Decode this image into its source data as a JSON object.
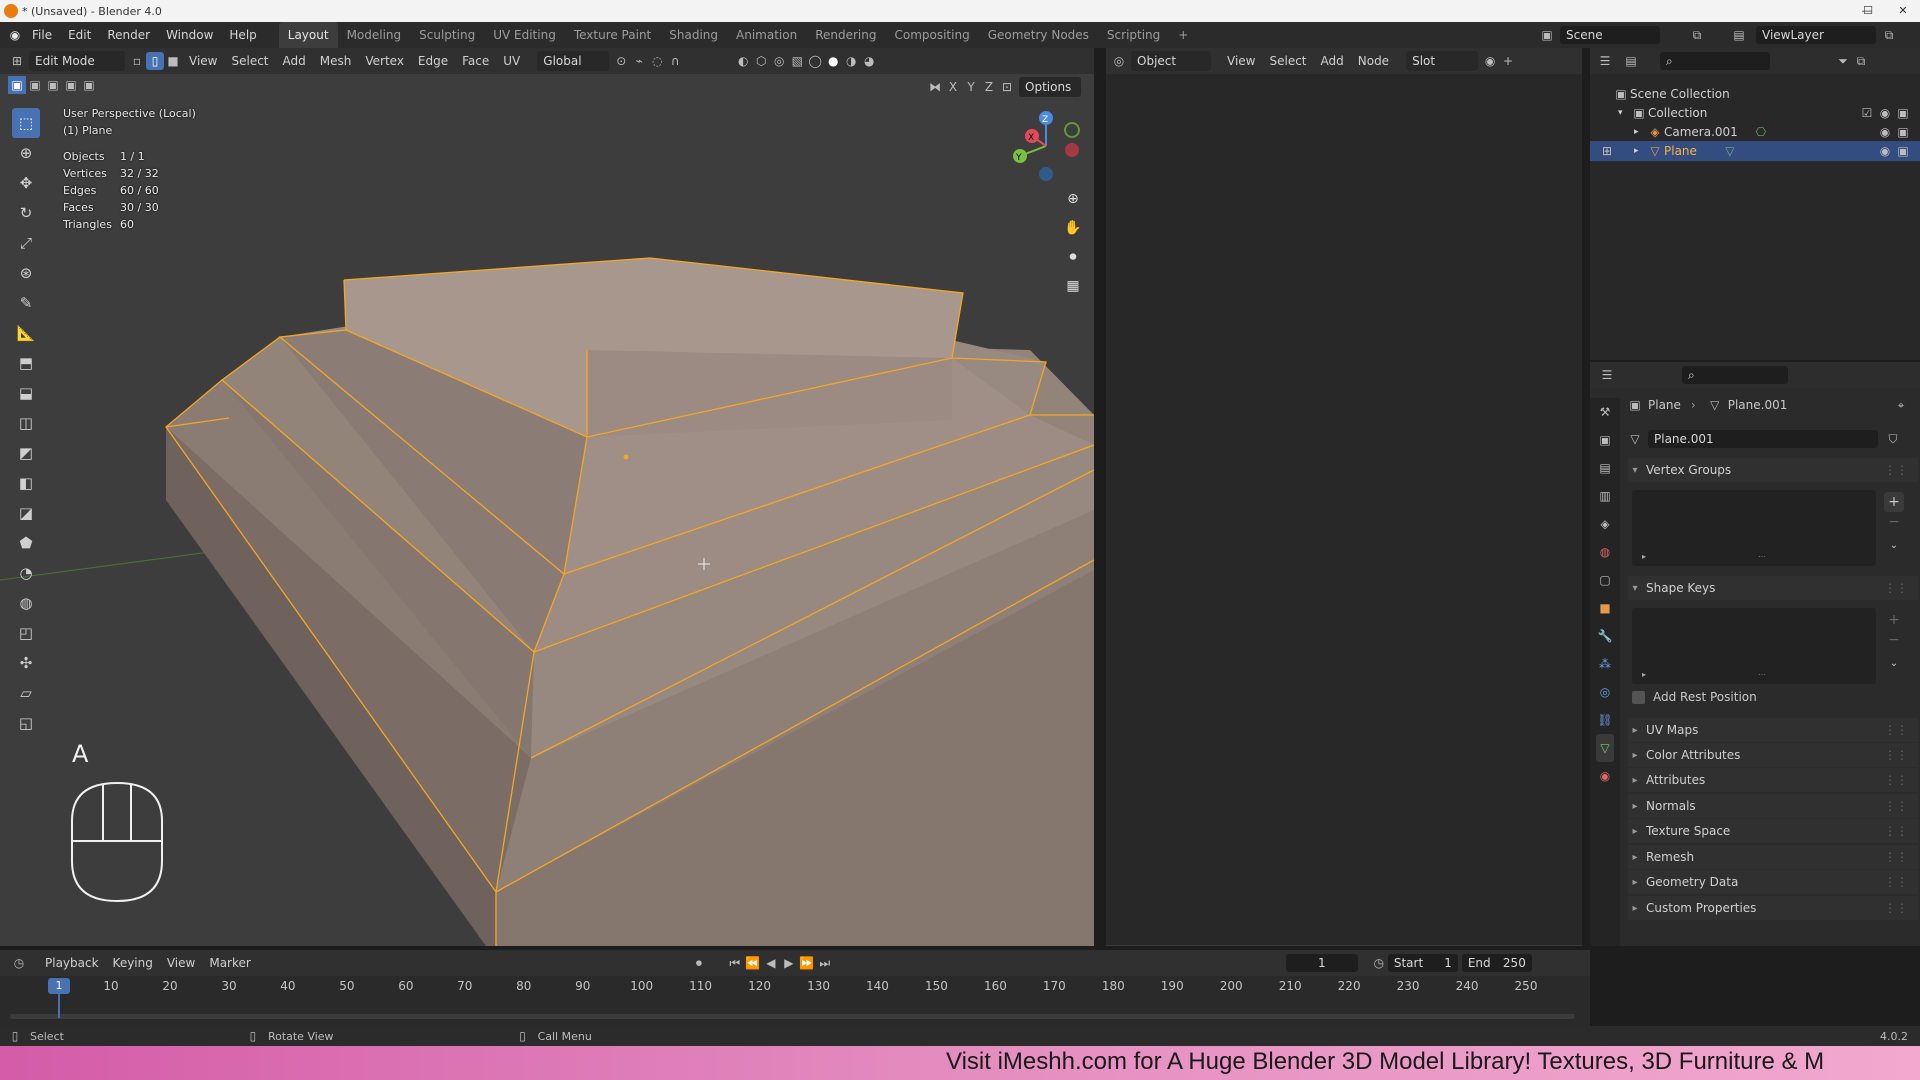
{
  "window": {
    "title": "* (Unsaved) - Blender 4.0",
    "minimize": "—",
    "maximize": "☐",
    "close": "✕"
  },
  "menu": [
    "File",
    "Edit",
    "Render",
    "Window",
    "Help"
  ],
  "workspaces": [
    "Layout",
    "Modeling",
    "Sculpting",
    "UV Editing",
    "Texture Paint",
    "Shading",
    "Animation",
    "Rendering",
    "Compositing",
    "Geometry Nodes",
    "Scripting"
  ],
  "workspace_add": "+",
  "scene": {
    "name": "Scene",
    "view_layer": "ViewLayer"
  },
  "viewport": {
    "mode": "Edit Mode",
    "menus": [
      "View",
      "Select",
      "Add",
      "Mesh",
      "Vertex",
      "Edge",
      "Face",
      "UV"
    ],
    "orientation": "Global",
    "axes": [
      "X",
      "Y",
      "Z"
    ],
    "options_label": "Options",
    "overlay_title": "User Perspective (Local)",
    "overlay_object": "(1) Plane",
    "stats": [
      {
        "label": "Objects",
        "value": "1 / 1"
      },
      {
        "label": "Vertices",
        "value": "32 / 32"
      },
      {
        "label": "Edges",
        "value": "60 / 60"
      },
      {
        "label": "Faces",
        "value": "30 / 30"
      },
      {
        "label": "Triangles",
        "value": "60"
      }
    ],
    "key_hint": "A",
    "gizmo": {
      "z": "Z",
      "y": "Y",
      "x": "X"
    }
  },
  "node_editor": {
    "type": "Object",
    "menus": [
      "View",
      "Select",
      "Add",
      "Node"
    ],
    "slot": "Slot"
  },
  "outliner": {
    "items": [
      {
        "label": "Scene Collection",
        "indent": 0
      },
      {
        "label": "Collection",
        "indent": 1
      },
      {
        "label": "Camera.001",
        "indent": 2
      },
      {
        "label": "Plane",
        "indent": 2
      }
    ]
  },
  "properties": {
    "breadcrumb_object": "Plane",
    "breadcrumb_data": "Plane.001",
    "data_name": "Plane.001",
    "open_sections": [
      "Vertex Groups",
      "Shape Keys"
    ],
    "add_rest_position": "Add Rest Position",
    "closed_sections": [
      "UV Maps",
      "Color Attributes",
      "Attributes",
      "Normals",
      "Texture Space",
      "Remesh",
      "Geometry Data",
      "Custom Properties"
    ]
  },
  "timeline": {
    "menus": [
      "Playback",
      "Keying",
      "View",
      "Marker"
    ],
    "current_frame": "1",
    "start_label": "Start",
    "start": "1",
    "end_label": "End",
    "end": "250",
    "ticks": [
      "1",
      "10",
      "20",
      "30",
      "40",
      "50",
      "60",
      "70",
      "80",
      "90",
      "100",
      "110",
      "120",
      "130",
      "140",
      "150",
      "160",
      "170",
      "180",
      "190",
      "200",
      "210",
      "220",
      "230",
      "240",
      "250"
    ]
  },
  "statusbar": {
    "select": "Select",
    "rotate": "Rotate View",
    "call_menu": "Call Menu",
    "version": "4.0.2"
  },
  "banner": {
    "text": "Visit iMeshh.com for A Huge Blender 3D Model Library! Textures, 3D Furniture & M"
  },
  "colors": {
    "selection": "#f5a623",
    "active_tool": "#4772b3",
    "mesh_face": "#9a8a80",
    "banner": "#e48dc0"
  }
}
